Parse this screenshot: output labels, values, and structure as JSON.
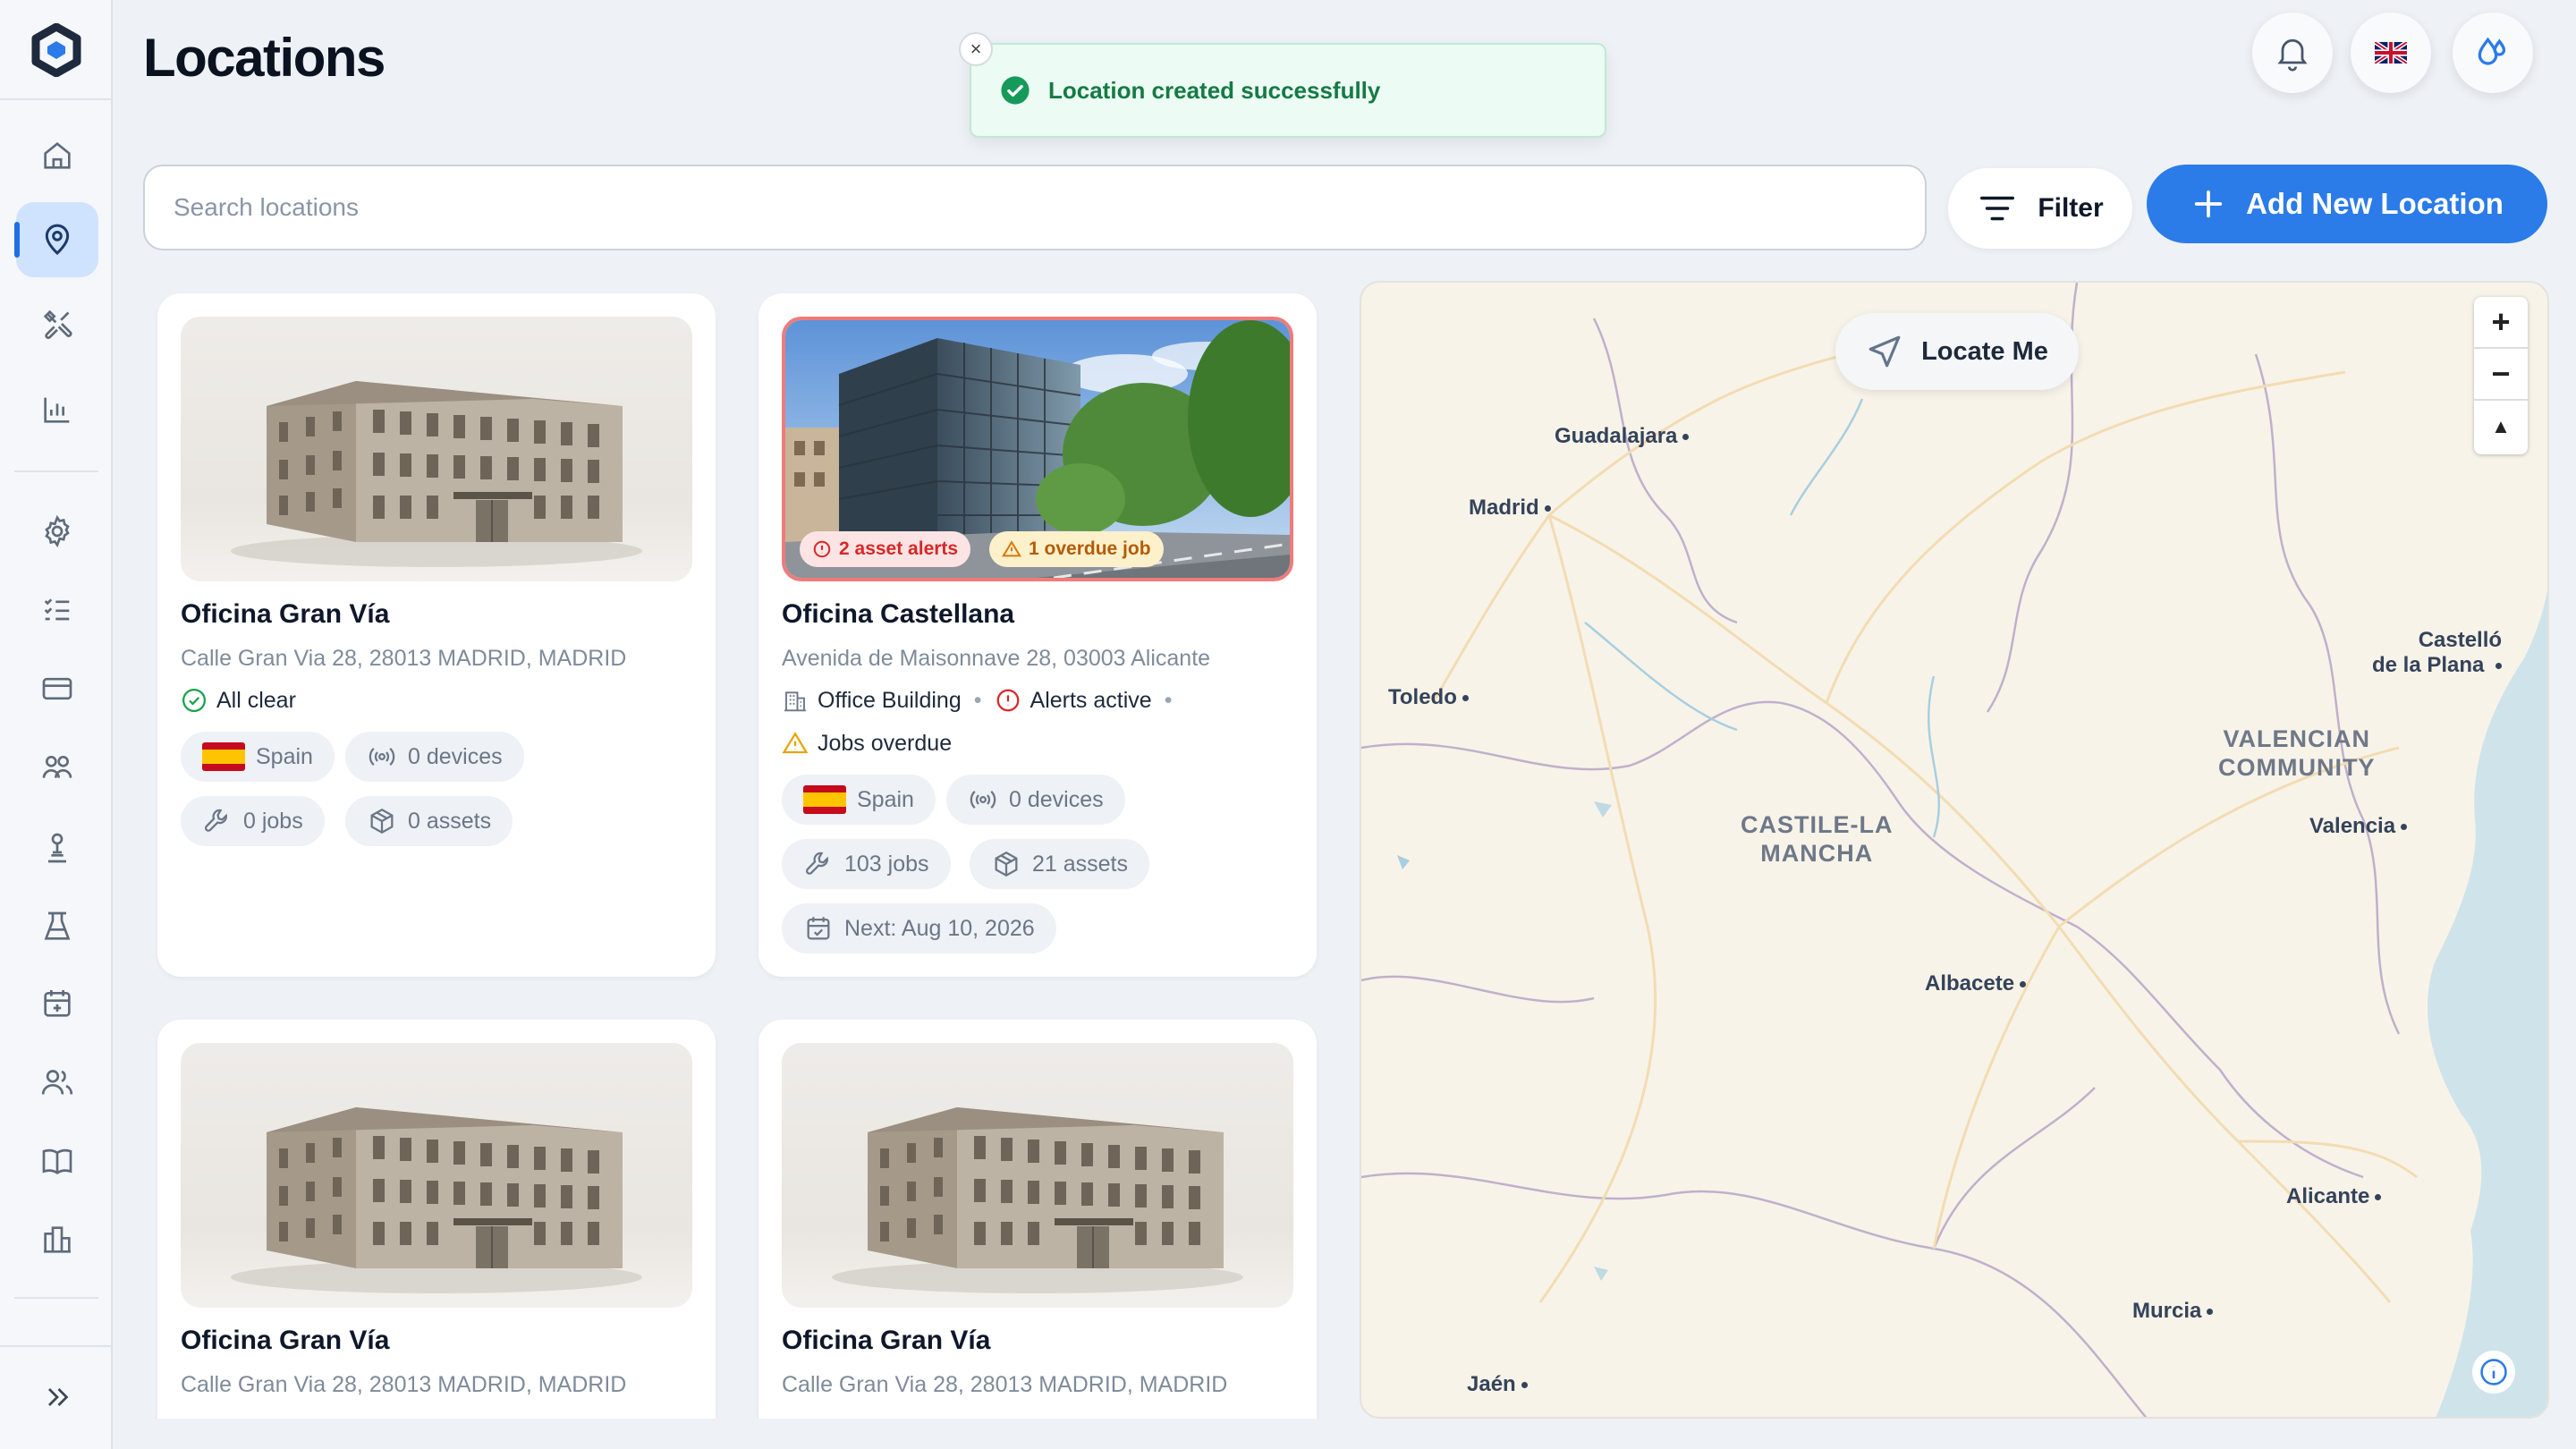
{
  "app": {
    "page_title": "Locations"
  },
  "toast": {
    "message": "Location created successfully",
    "close": "×"
  },
  "header": {
    "language_flag_icon": "uk-flag-icon",
    "notification_icon": "bell-icon",
    "brand_icon": "droplet-icon"
  },
  "search": {
    "placeholder": "Search locations",
    "value": ""
  },
  "toolbar": {
    "filter_label": "Filter",
    "add_label": "Add New Location"
  },
  "sidebar": {
    "items": [
      {
        "name": "home",
        "icon": "home-icon",
        "active": false
      },
      {
        "name": "locations",
        "icon": "map-pin-icon",
        "active": true
      },
      {
        "name": "tools",
        "icon": "tools-icon",
        "active": false
      },
      {
        "name": "analytics",
        "icon": "bar-chart-icon",
        "active": false
      },
      {
        "name": "settings",
        "icon": "gear-icon",
        "active": false
      },
      {
        "name": "checklists",
        "icon": "checklist-icon",
        "active": false
      },
      {
        "name": "billing",
        "icon": "card-icon",
        "active": false
      },
      {
        "name": "teams",
        "icon": "group-icon",
        "active": false
      },
      {
        "name": "operators",
        "icon": "worker-icon",
        "active": false
      },
      {
        "name": "lab",
        "icon": "flask-icon",
        "active": false
      },
      {
        "name": "calendar",
        "icon": "calendar-icon",
        "active": false
      },
      {
        "name": "users",
        "icon": "users-icon",
        "active": false
      },
      {
        "name": "docs",
        "icon": "book-icon",
        "active": false
      },
      {
        "name": "buildings",
        "icon": "buildings-icon",
        "active": false
      }
    ],
    "expand_icon": "chevrons-right-icon"
  },
  "cards": [
    {
      "name": "Oficina Gran Vía",
      "address": "Calle Gran Via 28, 28013 MADRID, MADRID",
      "status": "All clear",
      "country": "Spain",
      "devices": "0 devices",
      "jobs": "0 jobs",
      "assets": "0 assets"
    },
    {
      "name": "Oficina Castellana",
      "address": "Avenida de Maisonnave 28, 03003 Alicante",
      "badge_alerts": "2 asset alerts",
      "badge_overdue": "1 overdue job",
      "type": "Office Building",
      "alerts": "Alerts active",
      "jobs_overdue": "Jobs overdue",
      "country": "Spain",
      "devices": "0 devices",
      "jobs": "103 jobs",
      "assets": "21 assets",
      "next": "Next: Aug 10, 2026"
    },
    {
      "name": "Oficina Gran Vía",
      "address": "Calle Gran Via 28, 28013 MADRID, MADRID"
    },
    {
      "name": "Oficina Gran Vía",
      "address": "Calle Gran Via 28, 28013 MADRID, MADRID"
    }
  ],
  "map": {
    "locate_label": "Locate Me",
    "zoom_in": "+",
    "zoom_out": "−",
    "reset": "▲",
    "cities": {
      "guadalajara": "Guadalajara",
      "madrid": "Madrid",
      "toledo": "Toledo",
      "castello_1": "Castelló",
      "castello_2": "de la Plana",
      "valencia": "Valencia",
      "albacete": "Albacete",
      "alicante": "Alicante",
      "murcia": "Murcia",
      "jaen": "Jaén"
    },
    "regions": {
      "valencian_1": "VALENCIAN",
      "valencian_2": "COMMUNITY",
      "castile_1": "CASTILE-LA",
      "castile_2": "MANCHA"
    },
    "colors": {
      "land": "#f8f3e9",
      "sea": "#cfe3ea",
      "roads": "#f3dcb2",
      "borders": "#b9a9c9"
    }
  }
}
